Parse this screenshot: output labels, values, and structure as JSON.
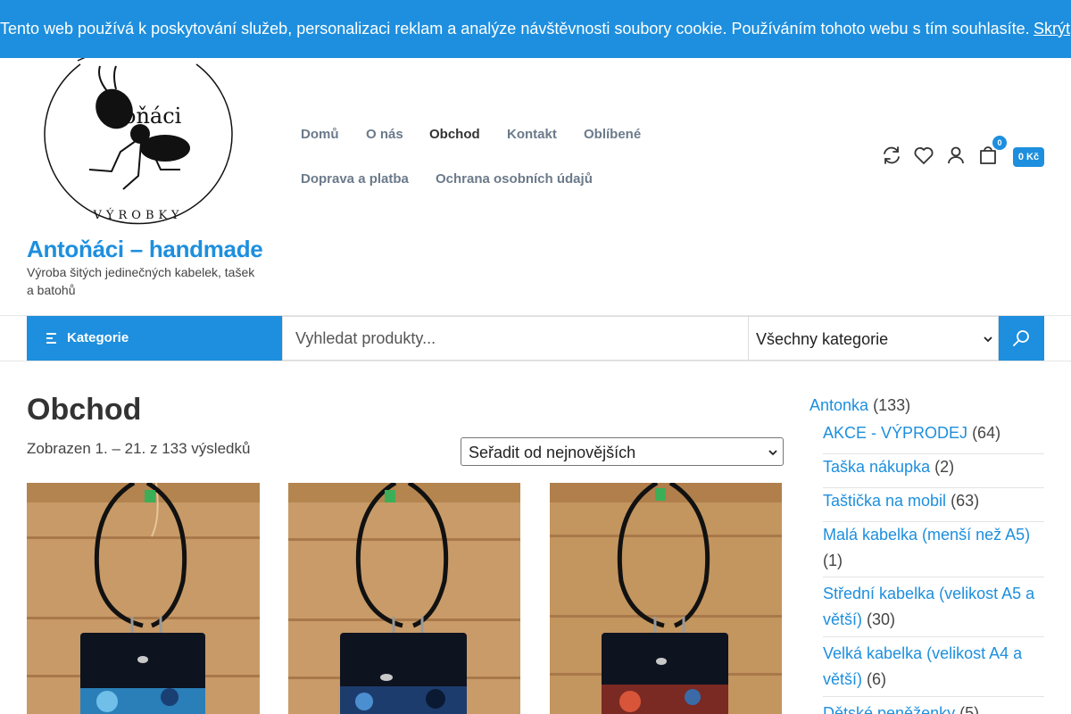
{
  "cookie_banner": {
    "text": "Tento web používá k poskytování služeb, personalizaci reklam a analýze návštěvnosti soubory cookie. Používáním tohoto webu s tím souhlasíte.",
    "hide_link": "Skrýt"
  },
  "header": {
    "logo_text_main": "oňáci",
    "logo_text_bottom": "VÝROBKY",
    "site_title": "Antoňáci – handmade",
    "tagline": "Výroba šitých jedinečných kabelek, tašek a batohů",
    "nav": [
      {
        "label": "Domů"
      },
      {
        "label": "O nás"
      },
      {
        "label": "Obchod",
        "active": true
      },
      {
        "label": "Kontakt"
      },
      {
        "label": "Oblíbené"
      },
      {
        "label": "Doprava a platba"
      },
      {
        "label": "Ochrana osobních údajů"
      }
    ],
    "icons": [
      "compare-icon",
      "heart-icon",
      "user-icon",
      "cart-icon"
    ],
    "cart_count": "0",
    "cart_total": "0 Kč"
  },
  "search_bar": {
    "categories_button": "Kategorie",
    "placeholder": "Vyhledat produkty...",
    "category_select": "Všechny kategorie"
  },
  "main": {
    "page_title": "Obchod",
    "result_count": "Zobrazen 1. – 21. z 133 výsledků",
    "sort_select": "Seřadit od nejnovějších"
  },
  "products": [
    {
      "image": "black crossbody phone bag with blue pattern on wooden background"
    },
    {
      "image": "black crossbody phone bag with blue-black pattern on wooden background"
    },
    {
      "image": "black crossbody phone bag with red pattern on wooden background"
    }
  ],
  "sidebar": {
    "root": {
      "label": "Antonka",
      "count": "(133)"
    },
    "items": [
      {
        "label": "AKCE - VÝPRODEJ",
        "count": "(64)"
      },
      {
        "label": "Taška nákupka",
        "count": "(2)"
      },
      {
        "label": "Taštička na mobil",
        "count": "(63)"
      },
      {
        "label": "Malá kabelka (menší než A5)",
        "count": "(1)"
      },
      {
        "label": "Střední kabelka (velikost A5 a větší)",
        "count": "(30)"
      },
      {
        "label": "Velká kabelka (velikost A4 a větší)",
        "count": "(6)"
      },
      {
        "label": "Dětské peněženky",
        "count": "(5)"
      }
    ]
  },
  "colors": {
    "accent": "#1d8fde",
    "nav_text": "#6b7a8a",
    "wood": "#c79a68"
  }
}
